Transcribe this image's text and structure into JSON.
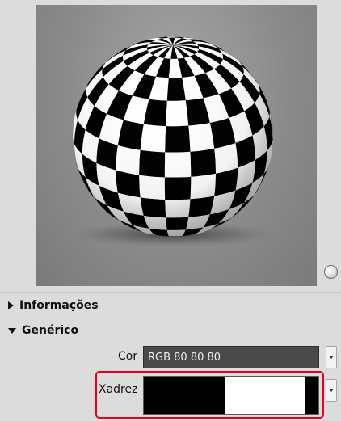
{
  "preview": {
    "checker_dark": "#000000",
    "checker_light": "#ffffff",
    "background": "#8b8b8b"
  },
  "sections": [
    {
      "label": "Informações",
      "expanded": false
    },
    {
      "label": "Genérico",
      "expanded": true
    }
  ],
  "properties": {
    "cor": {
      "label": "Cor",
      "value": "RGB 80 80 80"
    },
    "xadrez": {
      "label": "Xadrez",
      "swatch": [
        "#000000",
        "#ffffff",
        "#000000"
      ]
    }
  },
  "colors": {
    "highlight": "#e8001c",
    "field_bg": "#4a4a4a"
  }
}
